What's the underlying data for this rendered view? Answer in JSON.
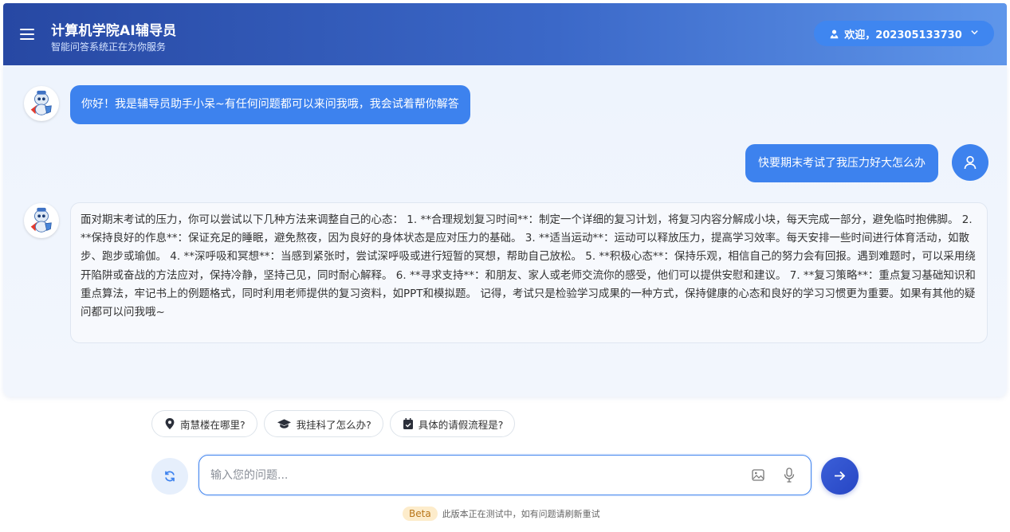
{
  "header": {
    "title": "计算机学院AI辅导员",
    "subtitle": "智能问答系统正在为你服务",
    "welcome": "欢迎，202305133730"
  },
  "colors": {
    "header_start": "#2748a3",
    "header_end": "#5f96ea",
    "accent": "#3d82ee",
    "send": "#2746c4"
  },
  "messages": {
    "bot_greeting": "你好！我是辅导员助手小呆~有任何问题都可以来问我哦，我会试着帮你解答",
    "user_question": "快要期末考试了我压力好大怎么办",
    "bot_answer": "面对期末考试的压力，你可以尝试以下几种方法来调整自己的心态： 1. **合理规划复习时间**：制定一个详细的复习计划，将复习内容分解成小块，每天完成一部分，避免临时抱佛脚。 2. **保持良好的作息**：保证充足的睡眠，避免熬夜，因为良好的身体状态是应对压力的基础。 3. **适当运动**：运动可以释放压力，提高学习效率。每天安排一些时间进行体育活动，如散步、跑步或瑜伽。 4. **深呼吸和冥想**：当感到紧张时，尝试深呼吸或进行短暂的冥想，帮助自己放松。 5. **积极心态**：保持乐观，相信自己的努力会有回报。遇到难题时，可以采用绕开陷阱或奋战的方法应对，保持冷静，坚持己见，同时耐心解释。 6. **寻求支持**：和朋友、家人或老师交流你的感受，他们可以提供安慰和建议。 7. **复习策略**：重点复习基础知识和重点算法，牢记书上的例题格式，同时利用老师提供的复习资料，如PPT和模拟题。 记得，考试只是检验学习成果的一种方式，保持健康的心态和良好的学习习惯更为重要。如果有其他的疑问都可以问我哦~"
  },
  "suggestions": [
    {
      "icon": "location-pin-icon",
      "label": "南慧楼在哪里?"
    },
    {
      "icon": "graduation-cap-icon",
      "label": "我挂科了怎么办?"
    },
    {
      "icon": "calendar-check-icon",
      "label": "具体的请假流程是?"
    }
  ],
  "input": {
    "placeholder": "输入您的问题...",
    "value": ""
  },
  "footer": {
    "badge": "Beta",
    "text": "此版本正在测试中，如有问题请刷新重试"
  }
}
